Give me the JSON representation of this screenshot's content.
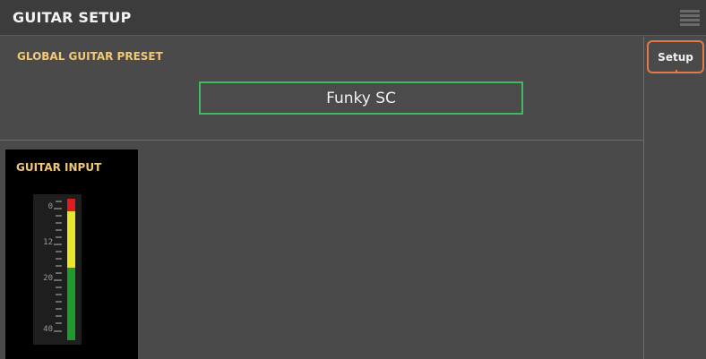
{
  "header": {
    "title": "GUITAR SETUP",
    "menu_icon": "menu-icon"
  },
  "global_preset": {
    "label": "GLOBAL GUITAR PRESET",
    "value": "Funky SC"
  },
  "guitar_input": {
    "label": "GUITAR INPUT",
    "meter": {
      "scale_labels": [
        "0",
        "12",
        "20",
        "40"
      ],
      "colors": {
        "red": "#e21a1a",
        "yellow": "#e6e62a",
        "green": "#1e9a2e"
      }
    }
  },
  "sidebar": {
    "tabs": [
      {
        "label": "Setup",
        "selected": true
      }
    ]
  },
  "colors": {
    "accent_label": "#f0c878",
    "preset_border": "#3fb860",
    "tab_selected_border": "#e07a4a"
  }
}
